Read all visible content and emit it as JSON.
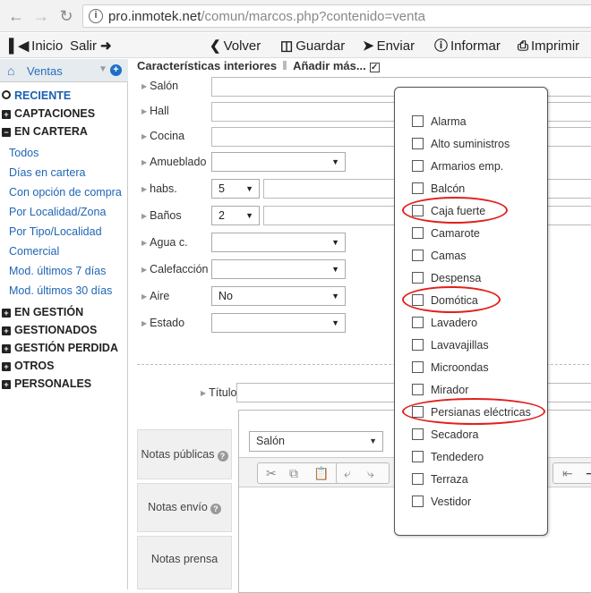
{
  "browser": {
    "url_main": "pro.inmotek.net",
    "url_path": "/comun/marcos.php?contenido=venta",
    "back_icon": "arrow-left-icon",
    "forward_icon": "arrow-right-icon",
    "reload_icon": "reload-icon"
  },
  "toolbar": {
    "inicio": "Inicio",
    "salir": "Salir",
    "volver": "Volver",
    "guardar": "Guardar",
    "enviar": "Enviar",
    "informar": "Informar",
    "imprimir": "Imprimir"
  },
  "sidebar": {
    "header": "Ventas",
    "sections": {
      "reciente": "RECIENTE",
      "captaciones": "CAPTACIONES",
      "en_cartera": "EN CARTERA",
      "en_gestion": "EN GESTIÓN",
      "gestionados": "GESTIONADOS",
      "gestion_perdida": "GESTIÓN PERDIDA",
      "otros": "OTROS",
      "personales": "PERSONALES"
    },
    "items": [
      "Todos",
      "Días en cartera",
      "Con opción de compra",
      "Por Localidad/Zona",
      "Por Tipo/Localidad",
      "Comercial",
      "Mod. últimos 7 días",
      "Mod. últimos 30 días"
    ]
  },
  "main": {
    "title": "Características interiores",
    "add_more": "Añadir más...",
    "fields": {
      "salon": "Salón",
      "hall": "Hall",
      "cocina": "Cocina",
      "amueblado": "Amueblado",
      "habs": "habs.",
      "habs_value": "5",
      "banos": "Baños",
      "banos_value": "2",
      "agua": "Agua c.",
      "calefaccion": "Calefacción",
      "aire": "Aire",
      "aire_value": "No",
      "estado": "Estado",
      "titulo": "Título"
    },
    "notes": {
      "publicas": "Notas públicas",
      "envio": "Notas envío",
      "prensa": "Notas prensa"
    },
    "editor_select": "Salón"
  },
  "popover": {
    "options": [
      "Alarma",
      "Alto suministros",
      "Armarios emp.",
      "Balcón",
      "Caja fuerte",
      "Camarote",
      "Camas",
      "Despensa",
      "Domótica",
      "Lavadero",
      "Lavavajillas",
      "Microondas",
      "Mirador",
      "Persianas eléctricas",
      "Secadora",
      "Tendedero",
      "Terraza",
      "Vestidor"
    ],
    "highlight_color": "#e0201c"
  }
}
